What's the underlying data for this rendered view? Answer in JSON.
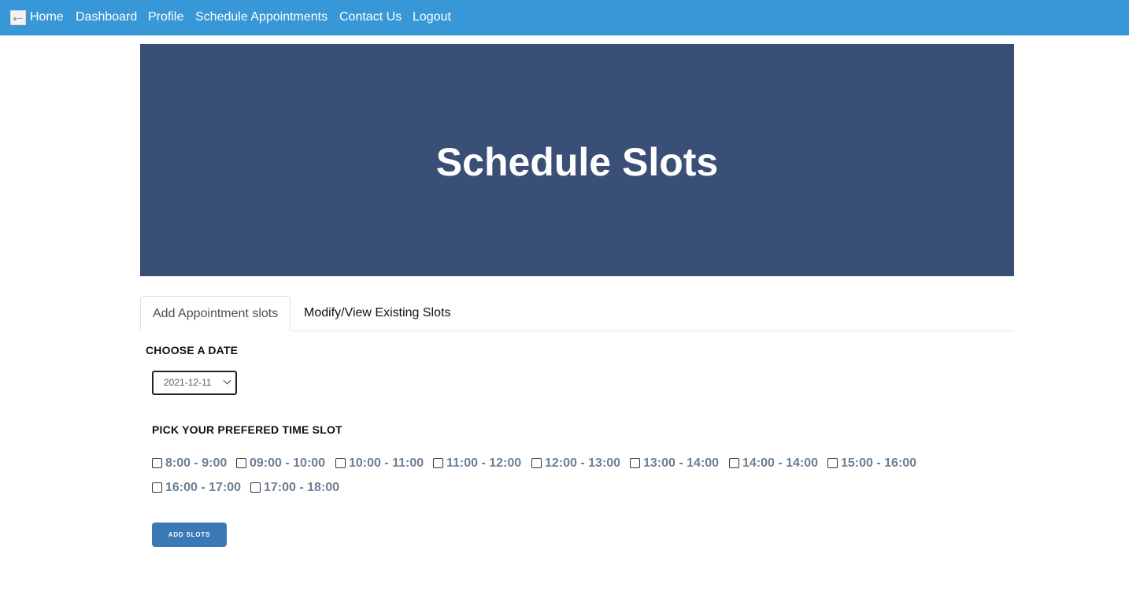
{
  "nav": {
    "items": [
      {
        "label": "Home"
      },
      {
        "label": "Dashboard"
      },
      {
        "label": "Profile"
      },
      {
        "label": "Schedule Appointments"
      },
      {
        "label": "Contact Us"
      },
      {
        "label": "Logout"
      }
    ]
  },
  "hero": {
    "title": "Schedule Slots"
  },
  "tabs": [
    {
      "label": "Add Appointment slots",
      "active": true
    },
    {
      "label": "Modify/View Existing Slots",
      "active": false
    }
  ],
  "form": {
    "date_label": "CHOOSE A DATE",
    "date_value": "2021-12-11",
    "slot_label": "PICK YOUR PREFERED TIME SLOT",
    "slots": [
      {
        "label": "8:00 - 9:00",
        "checked": false
      },
      {
        "label": "09:00 - 10:00",
        "checked": false
      },
      {
        "label": "10:00 - 11:00",
        "checked": false
      },
      {
        "label": "11:00 - 12:00",
        "checked": false
      },
      {
        "label": "12:00 - 13:00",
        "checked": false
      },
      {
        "label": "13:00 - 14:00",
        "checked": false
      },
      {
        "label": "14:00 - 14:00",
        "checked": false
      },
      {
        "label": "15:00 - 16:00",
        "checked": false
      },
      {
        "label": "16:00 - 17:00",
        "checked": false
      },
      {
        "label": "17:00 - 18:00",
        "checked": false
      }
    ],
    "submit_label": "ADD SLOTS"
  },
  "colors": {
    "navbar": "#3897d6",
    "hero": "#3a4f75",
    "button": "#3a79b5",
    "slot_text": "#6b7f96"
  }
}
